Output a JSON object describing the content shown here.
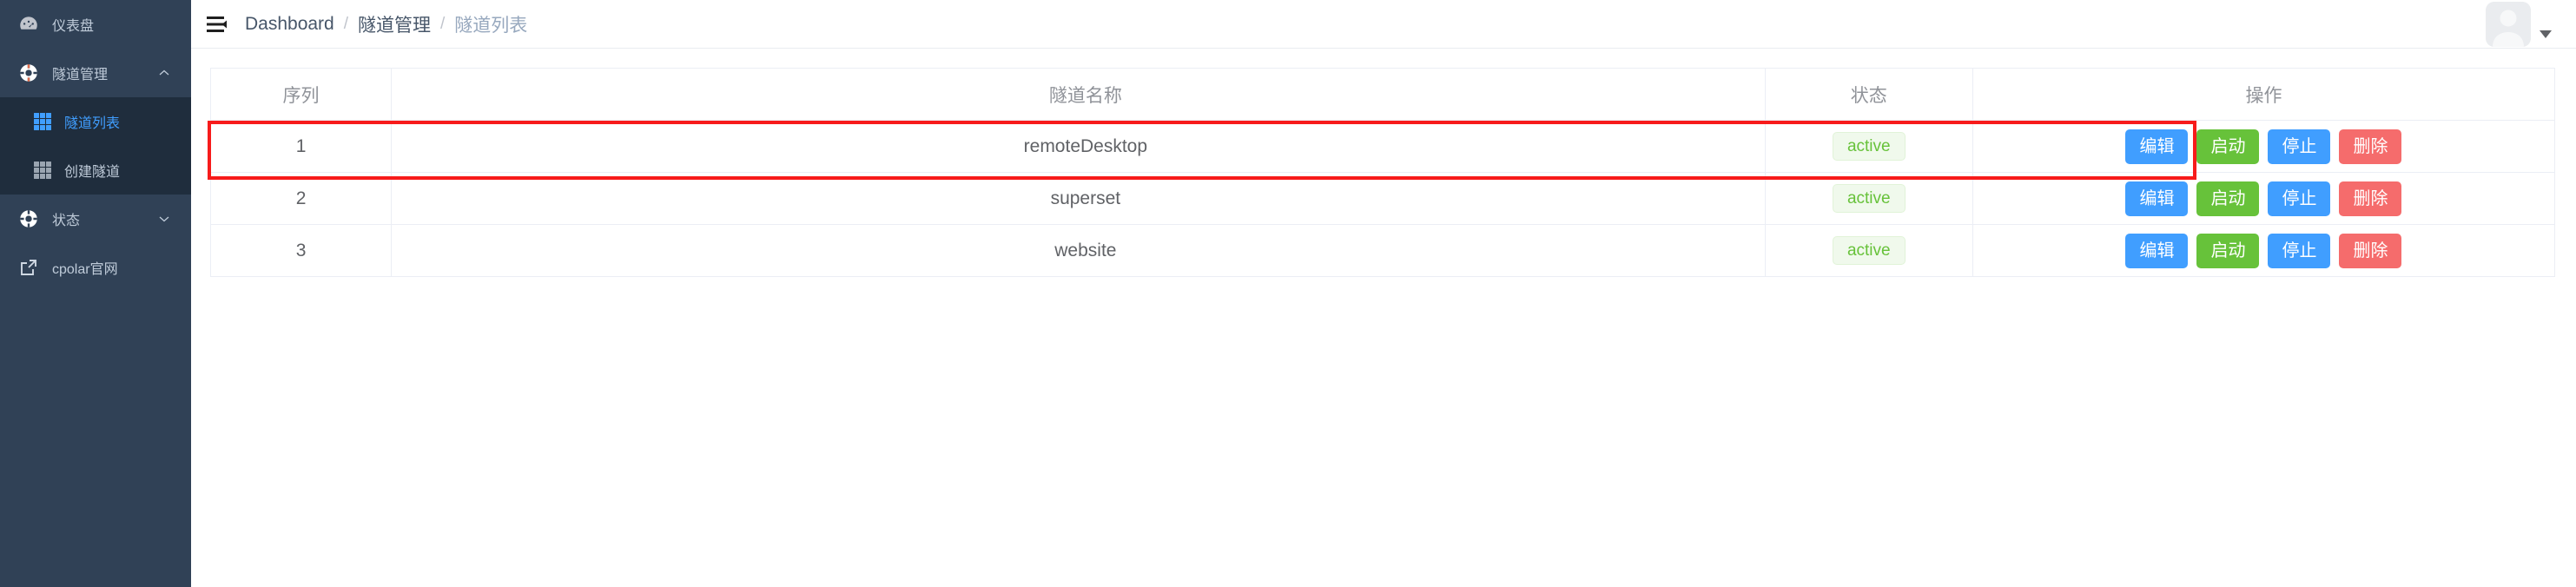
{
  "sidebar": {
    "background": "#304156",
    "submenu_background": "#1f2d3d",
    "active_color": "#409eff",
    "items": [
      {
        "label": "仪表盘",
        "icon": "dashboard-icon",
        "has_arrow": false
      },
      {
        "label": "隧道管理",
        "icon": "tunnel-icon",
        "has_arrow": true,
        "arrow": "chevron-up"
      },
      {
        "label": "状态",
        "icon": "status-icon",
        "has_arrow": true,
        "arrow": "chevron-down"
      },
      {
        "label": "cpolar官网",
        "icon": "external-link-icon",
        "has_arrow": false
      }
    ],
    "submenu": [
      {
        "label": "隧道列表",
        "icon": "grid-icon",
        "active": true
      },
      {
        "label": "创建隧道",
        "icon": "grid-icon",
        "active": false
      }
    ]
  },
  "navbar": {
    "hamburger_icon": "hamburger-collapse-icon",
    "breadcrumb": [
      {
        "label": "Dashboard",
        "current": false
      },
      {
        "label": "隧道管理",
        "current": false
      },
      {
        "label": "隧道列表",
        "current": true
      }
    ],
    "separator": "/",
    "avatar_icon": "user-avatar-placeholder",
    "caret_icon": "caret-down-icon"
  },
  "table": {
    "columns": [
      {
        "key": "seq",
        "label": "序列"
      },
      {
        "key": "name",
        "label": "隧道名称"
      },
      {
        "key": "state",
        "label": "状态"
      },
      {
        "key": "ops",
        "label": "操作"
      }
    ],
    "rows": [
      {
        "seq": "1",
        "name": "remoteDesktop",
        "state": "active",
        "buttons": [
          {
            "label": "编辑",
            "style": "primary"
          },
          {
            "label": "启动",
            "style": "success"
          },
          {
            "label": "停止",
            "style": "primary"
          },
          {
            "label": "删除",
            "style": "danger"
          }
        ]
      },
      {
        "seq": "2",
        "name": "superset",
        "state": "active",
        "buttons": [
          {
            "label": "编辑",
            "style": "primary"
          },
          {
            "label": "启动",
            "style": "success"
          },
          {
            "label": "停止",
            "style": "primary"
          },
          {
            "label": "删除",
            "style": "danger"
          }
        ]
      },
      {
        "seq": "3",
        "name": "website",
        "state": "active",
        "buttons": [
          {
            "label": "编辑",
            "style": "primary"
          },
          {
            "label": "启动",
            "style": "success"
          },
          {
            "label": "停止",
            "style": "primary"
          },
          {
            "label": "删除",
            "style": "danger"
          }
        ]
      }
    ]
  },
  "annotation": {
    "color": "#f71b1b",
    "target_row_index": 1
  },
  "colors": {
    "primary": "#409eff",
    "success": "#67c23a",
    "danger": "#f56c6c",
    "badge_bg": "#f0f9ec",
    "badge_text": "#67c23a",
    "sidebar_bg": "#304156",
    "submenu_bg": "#1f2d3d"
  }
}
